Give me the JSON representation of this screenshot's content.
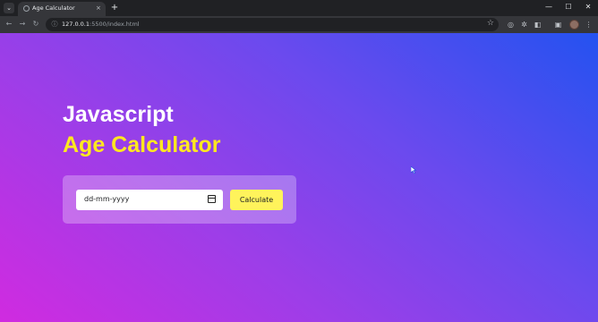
{
  "browser": {
    "tab": {
      "title": "Age Calculator",
      "close_glyph": "×"
    },
    "tab_list_glyph": "⌄",
    "new_tab_glyph": "+",
    "window_controls": {
      "minimize": "—",
      "maximize": "☐",
      "close": "✕"
    },
    "nav": {
      "back": "←",
      "forward": "→",
      "reload": "↻"
    },
    "address": {
      "host": "127.0.0.1",
      "rest": ":5500/index.html"
    },
    "bookmark_glyph": "☆",
    "toolbar_icons": [
      "account-circle-icon",
      "extension-icon",
      "puzzle-icon",
      "sidebar-icon"
    ]
  },
  "page": {
    "heading_line1": "Javascript",
    "heading_line2": "Age Calculator",
    "date_input": {
      "placeholder": "dd-mm-yyyy"
    },
    "calculate_label": "Calculate"
  },
  "colors": {
    "heading_accent": "#ffe81f",
    "button": "#fff35b",
    "gradient_start": "#d02be0",
    "gradient_end": "#2452f0"
  }
}
